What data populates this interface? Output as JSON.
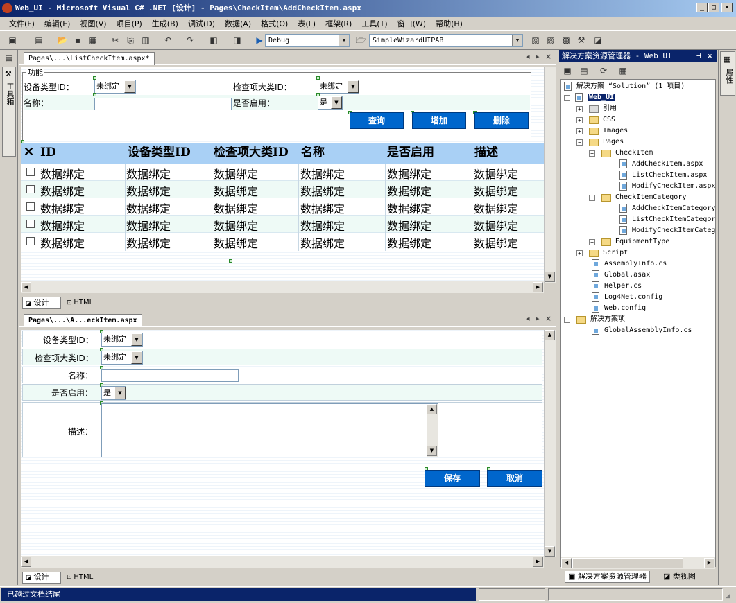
{
  "window": {
    "title": "Web_UI - Microsoft Visual C# .NET [设计] - Pages\\CheckItem\\AddCheckItem.aspx"
  },
  "menu": [
    "文件(F)",
    "编辑(E)",
    "视图(V)",
    "项目(P)",
    "生成(B)",
    "调试(D)",
    "数据(A)",
    "格式(O)",
    "表(L)",
    "框架(R)",
    "工具(T)",
    "窗口(W)",
    "帮助(H)"
  ],
  "toolbar": {
    "config": "Debug",
    "project": "SimpleWizardUIPAB"
  },
  "left_toolbox": {
    "label": "工具箱"
  },
  "right_panel": {
    "label": "属性"
  },
  "doc1": {
    "tab": "Pages\\...\\ListCheckItem.aspx*",
    "group_title": "功能",
    "labels": {
      "equip_type": "设备类型ID：",
      "check_cat": "检查项大类ID：",
      "name": "名称：",
      "enabled": "是否启用："
    },
    "selects": {
      "equip_type": "未绑定",
      "check_cat": "未绑定",
      "enabled": "是"
    },
    "buttons": {
      "query": "查询",
      "add": "增加",
      "delete": "删除"
    },
    "grid": {
      "columns": [
        "ID",
        "设备类型ID",
        "检查项大类ID",
        "名称",
        "是否启用",
        "描述"
      ],
      "rows": [
        [
          "数据绑定",
          "数据绑定",
          "数据绑定",
          "数据绑定",
          "数据绑定",
          "数据绑定"
        ],
        [
          "数据绑定",
          "数据绑定",
          "数据绑定",
          "数据绑定",
          "数据绑定",
          "数据绑定"
        ],
        [
          "数据绑定",
          "数据绑定",
          "数据绑定",
          "数据绑定",
          "数据绑定",
          "数据绑定"
        ],
        [
          "数据绑定",
          "数据绑定",
          "数据绑定",
          "数据绑定",
          "数据绑定",
          "数据绑定"
        ],
        [
          "数据绑定",
          "数据绑定",
          "数据绑定",
          "数据绑定",
          "数据绑定",
          "数据绑定"
        ]
      ]
    },
    "view_tabs": {
      "design": "设计",
      "html": "HTML"
    }
  },
  "doc2": {
    "tab": "Pages\\...\\A...eckItem.aspx",
    "labels": {
      "equip_type": "设备类型ID：",
      "check_cat": "检查项大类ID：",
      "name": "名称：",
      "enabled": "是否启用：",
      "desc": "描述："
    },
    "selects": {
      "equip_type": "未绑定",
      "check_cat": "未绑定",
      "enabled": "是"
    },
    "buttons": {
      "save": "保存",
      "cancel": "取消"
    },
    "view_tabs": {
      "design": "设计",
      "html": "HTML"
    }
  },
  "solution_explorer": {
    "title": "解决方案资源管理器 - Web_UI",
    "nodes": {
      "solution": "解决方案 “Solution” (1 项目)",
      "project": "Web_UI",
      "refs": "引用",
      "css": "CSS",
      "images": "Images",
      "pages": "Pages",
      "checkitem": "CheckItem",
      "add_ci": "AddCheckItem.aspx",
      "list_ci": "ListCheckItem.aspx",
      "mod_ci": "ModifyCheckItem.aspx",
      "checkitemcat": "CheckItemCategory",
      "add_cic": "AddCheckItemCategory.",
      "list_cic": "ListCheckItemCategory",
      "mod_cic": "ModifyCheckItemCatego",
      "equiptype": "EquipmentType",
      "script": "Script",
      "asminfo": "AssemblyInfo.cs",
      "global": "Global.asax",
      "helper": "Helper.cs",
      "log4net": "Log4Net.config",
      "webconfig": "Web.config",
      "solitems": "解决方案项",
      "globalasm": "GlobalAssemblyInfo.cs"
    },
    "bottom_tabs": {
      "explorer": "解决方案资源管理器",
      "classview": "类视图"
    }
  },
  "status": {
    "text": "已越过文档结尾"
  }
}
